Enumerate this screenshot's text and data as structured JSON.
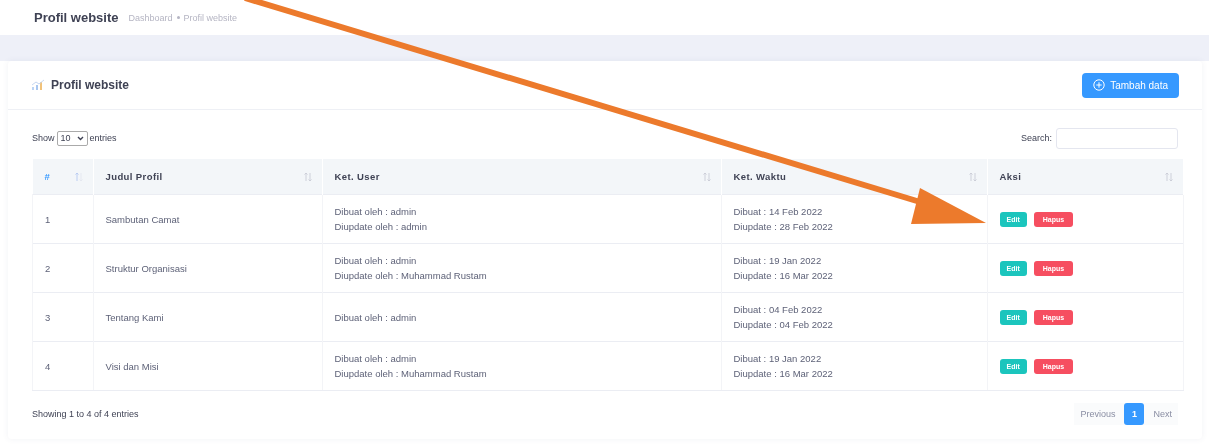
{
  "page": {
    "title": "Profil website",
    "breadcrumb": [
      "Dashboard",
      "Profil website"
    ]
  },
  "card": {
    "title": "Profil website",
    "add_button": "Tambah data"
  },
  "length": {
    "label_before": "Show",
    "value": "10",
    "label_after": "entries"
  },
  "search": {
    "label": "Search:"
  },
  "table": {
    "columns": [
      {
        "label": "#",
        "sorted": true
      },
      {
        "label": "Judul Profil",
        "sorted": false
      },
      {
        "label": "Ket. User",
        "sorted": false
      },
      {
        "label": "Ket. Waktu",
        "sorted": false
      },
      {
        "label": "Aksi",
        "sorted": false
      }
    ],
    "rows": [
      {
        "number": "1",
        "title": "Sambutan Camat",
        "user": [
          "Dibuat oleh : admin",
          "Diupdate oleh : admin"
        ],
        "time": [
          "Dibuat : 14 Feb 2022",
          "Diupdate : 28 Feb 2022"
        ],
        "actions": [
          {
            "label": "Edit",
            "kind": "edit"
          },
          {
            "label": "Hapus",
            "kind": "delete"
          }
        ]
      },
      {
        "number": "2",
        "title": "Struktur Organisasi",
        "user": [
          "Dibuat oleh : admin",
          "Diupdate oleh : Muhammad Rustam"
        ],
        "time": [
          "Dibuat : 19 Jan 2022",
          "Diupdate : 16 Mar 2022"
        ],
        "actions": [
          {
            "label": "Edit",
            "kind": "edit"
          },
          {
            "label": "Hapus",
            "kind": "delete"
          }
        ]
      },
      {
        "number": "3",
        "title": "Tentang Kami",
        "user": [
          "Dibuat oleh : admin"
        ],
        "time": [
          "Dibuat : 04 Feb 2022",
          "Diupdate : 04 Feb 2022"
        ],
        "actions": [
          {
            "label": "Edit",
            "kind": "edit"
          },
          {
            "label": "Hapus",
            "kind": "delete"
          }
        ]
      },
      {
        "number": "4",
        "title": "Visi dan Misi",
        "user": [
          "Dibuat oleh : admin",
          "Diupdate oleh : Muhammad Rustam"
        ],
        "time": [
          "Dibuat : 19 Jan 2022",
          "Diupdate : 16 Mar 2022"
        ],
        "actions": [
          {
            "label": "Edit",
            "kind": "edit"
          },
          {
            "label": "Hapus",
            "kind": "delete"
          }
        ]
      }
    ]
  },
  "info": "Showing 1 to 4 of 4 entries",
  "pagination": {
    "previous": {
      "label": "Previous",
      "disabled": true
    },
    "pages": [
      {
        "label": "1",
        "selected": true
      }
    ],
    "next": {
      "label": "Next",
      "disabled": true
    }
  }
}
